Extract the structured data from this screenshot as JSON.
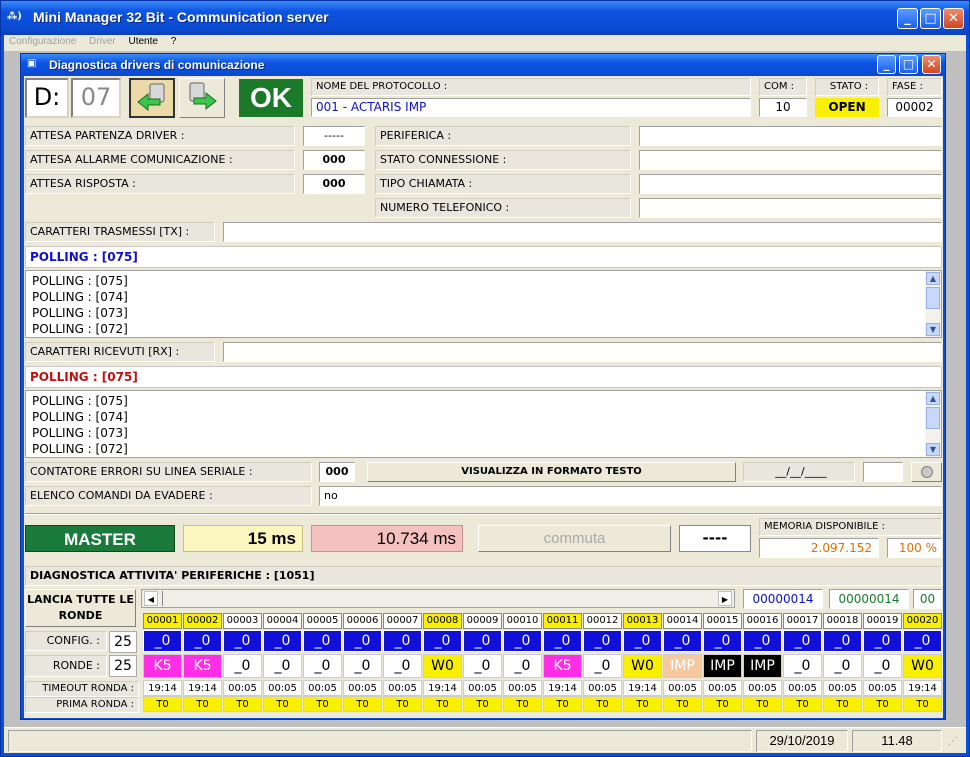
{
  "window": {
    "title": "Mini Manager 32 Bit - Communication server",
    "icon_text": "⁂)"
  },
  "menu": [
    {
      "label": "Configurazione",
      "enabled": false
    },
    {
      "label": "Driver",
      "enabled": false
    },
    {
      "label": "Utente",
      "enabled": true
    },
    {
      "label": "?",
      "enabled": true
    }
  ],
  "child": {
    "title": "Diagnostica drivers di comunicazione"
  },
  "top": {
    "d_label": "D:",
    "d_value": "07",
    "ok_label": "OK",
    "protocol_label": "NOME DEL PROTOCOLLO :",
    "protocol_value": "001 - ACTARIS IMP",
    "com_label": "COM :",
    "com_value": "10",
    "stato_label": "STATO :",
    "stato_value": "OPEN",
    "fase_label": "FASE :",
    "fase_value": "00002"
  },
  "info": {
    "attesa_partenza_label": "ATTESA PARTENZA DRIVER :",
    "attesa_partenza_value": "-----",
    "attesa_allarme_label": "ATTESA ALLARME COMUNICAZIONE :",
    "attesa_allarme_value": "000",
    "attesa_risposta_label": "ATTESA RISPOSTA :",
    "attesa_risposta_value": "000",
    "periferica_label": "PERIFERICA :",
    "periferica_value": "",
    "stato_conn_label": "STATO CONNESSIONE :",
    "stato_conn_value": "",
    "tipo_chiamata_label": "TIPO CHIAMATA :",
    "tipo_chiamata_value": "",
    "numero_tel_label": "NUMERO TELEFONICO :",
    "numero_tel_value": ""
  },
  "tx": {
    "label": "CARATTERI TRASMESSI [TX] :",
    "value": "",
    "current": "POLLING : [075]",
    "lines": [
      "POLLING : [075]",
      "POLLING : [074]",
      "POLLING : [073]",
      "POLLING : [072]"
    ]
  },
  "rx": {
    "label": "CARATTERI RICEVUTI [RX] :",
    "value": "",
    "current": "POLLING : [075]",
    "lines": [
      "POLLING : [075]",
      "POLLING : [074]",
      "POLLING : [073]",
      "POLLING : [072]"
    ]
  },
  "errors": {
    "label": "CONTATORE ERRORI SU LINEA SERIALE :",
    "value": "000",
    "button": "VISUALIZZA IN FORMATO TESTO",
    "date": "__/__/____",
    "extra": ""
  },
  "commands": {
    "label": "ELENCO COMANDI DA EVADERE :",
    "value": "no"
  },
  "master": {
    "label": "MASTER",
    "ms1": "15 ms",
    "ms2": "10.734 ms",
    "commuta": "commuta",
    "dashes": "----",
    "memoria_label": "MEMORIA DISPONIBILE :",
    "memoria_value": "2.097.152",
    "memoria_pct": "100 %"
  },
  "diag": {
    "label": "DIAGNOSTICA ATTIVITA' PERIFERICHE : [1051]",
    "lancia": "LANCIA TUTTE LE RONDE",
    "counter1": "00000014",
    "counter2": "00000014",
    "counter3": "00",
    "config_label": "CONFIG. :",
    "config_value": "25",
    "ronde_label": "RONDE :",
    "ronde_value": "25",
    "timeout_label": "TIMEOUT RONDA :",
    "prima_label": "PRIMA RONDA :",
    "columns": [
      {
        "id": "00001",
        "hl": true,
        "cfg": "_0",
        "r": "K5",
        "rc": "magenta",
        "t": "19:14",
        "p": "T0"
      },
      {
        "id": "00002",
        "hl": true,
        "cfg": "_0",
        "r": "K5",
        "rc": "magenta",
        "t": "19:14",
        "p": "T0"
      },
      {
        "id": "00003",
        "hl": false,
        "cfg": "_0",
        "r": "_0",
        "rc": "white",
        "t": "00:05",
        "p": "T0"
      },
      {
        "id": "00004",
        "hl": false,
        "cfg": "_0",
        "r": "_0",
        "rc": "white",
        "t": "00:05",
        "p": "T0"
      },
      {
        "id": "00005",
        "hl": false,
        "cfg": "_0",
        "r": "_0",
        "rc": "white",
        "t": "00:05",
        "p": "T0"
      },
      {
        "id": "00006",
        "hl": false,
        "cfg": "_0",
        "r": "_0",
        "rc": "white",
        "t": "00:05",
        "p": "T0"
      },
      {
        "id": "00007",
        "hl": false,
        "cfg": "_0",
        "r": "_0",
        "rc": "white",
        "t": "00:05",
        "p": "T0"
      },
      {
        "id": "00008",
        "hl": true,
        "cfg": "_0",
        "r": "W0",
        "rc": "yellow",
        "t": "19:14",
        "p": "T0"
      },
      {
        "id": "00009",
        "hl": false,
        "cfg": "_0",
        "r": "_0",
        "rc": "white",
        "t": "00:05",
        "p": "T0"
      },
      {
        "id": "00010",
        "hl": false,
        "cfg": "_0",
        "r": "_0",
        "rc": "white",
        "t": "00:05",
        "p": "T0"
      },
      {
        "id": "00011",
        "hl": true,
        "cfg": "_0",
        "r": "K5",
        "rc": "magenta",
        "t": "19:14",
        "p": "T0"
      },
      {
        "id": "00012",
        "hl": false,
        "cfg": "_0",
        "r": "_0",
        "rc": "white",
        "t": "00:05",
        "p": "T0"
      },
      {
        "id": "00013",
        "hl": true,
        "cfg": "_0",
        "r": "W0",
        "rc": "yellow",
        "t": "19:14",
        "p": "T0"
      },
      {
        "id": "00014",
        "hl": false,
        "cfg": "_0",
        "r": "IMP",
        "rc": "peach",
        "t": "00:05",
        "p": "T0"
      },
      {
        "id": "00015",
        "hl": false,
        "cfg": "_0",
        "r": "IMP",
        "rc": "black",
        "t": "00:05",
        "p": "T0"
      },
      {
        "id": "00016",
        "hl": false,
        "cfg": "_0",
        "r": "IMP",
        "rc": "black",
        "t": "00:05",
        "p": "T0"
      },
      {
        "id": "00017",
        "hl": false,
        "cfg": "_0",
        "r": "_0",
        "rc": "white",
        "t": "00:05",
        "p": "T0"
      },
      {
        "id": "00018",
        "hl": false,
        "cfg": "_0",
        "r": "_0",
        "rc": "white",
        "t": "00:05",
        "p": "T0"
      },
      {
        "id": "00019",
        "hl": false,
        "cfg": "_0",
        "r": "_0",
        "rc": "white",
        "t": "00:05",
        "p": "T0"
      },
      {
        "id": "00020",
        "hl": true,
        "cfg": "_0",
        "r": "W0",
        "rc": "yellow",
        "t": "19:14",
        "p": "T0"
      }
    ]
  },
  "statusbar": {
    "date": "29/10/2019",
    "time": "11.48"
  },
  "colors": {
    "ok_green": "#1a7a2a",
    "config_blue": "#1010d8",
    "highlight_yellow": "#f8f000",
    "magenta": "#ff2ee6"
  }
}
